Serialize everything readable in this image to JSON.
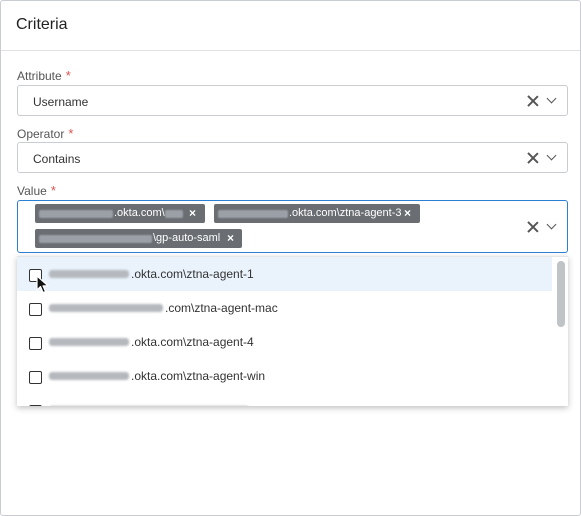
{
  "panel": {
    "title": "Criteria"
  },
  "attribute": {
    "label": "Attribute",
    "required_mark": "*",
    "value": "Username"
  },
  "operator": {
    "label": "Operator",
    "required_mark": "*",
    "value": "Contains"
  },
  "value_field": {
    "label": "Value",
    "required_mark": "*",
    "chips": [
      {
        "text": ".okta.com\\"
      },
      {
        "text": ".okta.com\\ztna-agent-3"
      },
      {
        "text": "\\gp-auto-saml"
      }
    ],
    "chip_remove_glyph": "×"
  },
  "dropdown": {
    "options": [
      {
        "text": ".okta.com\\ztna-agent-1",
        "checked": false
      },
      {
        "text": ".com\\ztna-agent-mac",
        "checked": false
      },
      {
        "text": ".okta.com\\ztna-agent-4",
        "checked": false
      },
      {
        "text": ".okta.com\\ztna-agent-win",
        "checked": false
      }
    ]
  },
  "icons": {
    "clear": "clear-icon",
    "chevron": "chevron-down-icon",
    "cursor": "mouse-pointer-icon"
  },
  "colors": {
    "accent": "#2c7fd2",
    "required": "#d9534f",
    "chip": "#6a6e73",
    "hover": "#eaf3fc"
  }
}
